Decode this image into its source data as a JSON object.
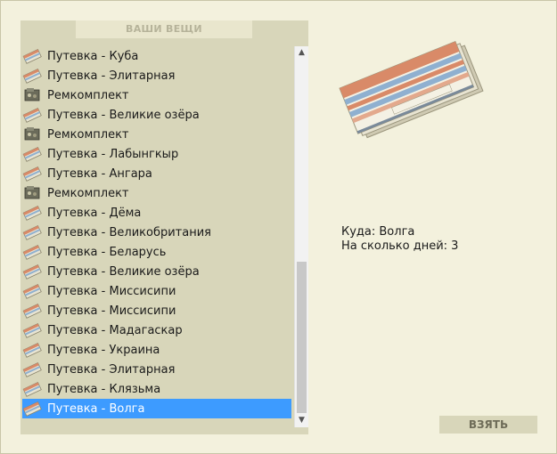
{
  "header": {
    "title": "ВАШИ ВЕЩИ"
  },
  "items": [
    {
      "label": "Путевка - Куба",
      "type": "ticket"
    },
    {
      "label": "Путевка - Элитарная",
      "type": "ticket"
    },
    {
      "label": "Ремкомплект",
      "type": "kit"
    },
    {
      "label": "Путевка - Великие озёра",
      "type": "ticket"
    },
    {
      "label": "Ремкомплект",
      "type": "kit"
    },
    {
      "label": "Путевка - Лабынгкыр",
      "type": "ticket"
    },
    {
      "label": "Путевка - Ангара",
      "type": "ticket"
    },
    {
      "label": "Ремкомплект",
      "type": "kit"
    },
    {
      "label": "Путевка - Дёма",
      "type": "ticket"
    },
    {
      "label": "Путевка - Великобритания",
      "type": "ticket"
    },
    {
      "label": "Путевка - Беларусь",
      "type": "ticket"
    },
    {
      "label": "Путевка - Великие озёра",
      "type": "ticket"
    },
    {
      "label": "Путевка - Миссисипи",
      "type": "ticket"
    },
    {
      "label": "Путевка - Миссисипи",
      "type": "ticket"
    },
    {
      "label": "Путевка - Мадагаскар",
      "type": "ticket"
    },
    {
      "label": "Путевка - Украина",
      "type": "ticket"
    },
    {
      "label": "Путевка - Элитарная",
      "type": "ticket"
    },
    {
      "label": "Путевка - Клязьма",
      "type": "ticket"
    },
    {
      "label": "Путевка - Волга",
      "type": "ticket",
      "selected": true
    }
  ],
  "details": {
    "destination_line": "Куда: Волга",
    "days_line": "На сколько дней: 3"
  },
  "actions": {
    "take_label": "ВЗЯТЬ"
  },
  "colors": {
    "panel": "#d8d6ba",
    "background": "#f3f1dd",
    "selection": "#3d9bff"
  }
}
